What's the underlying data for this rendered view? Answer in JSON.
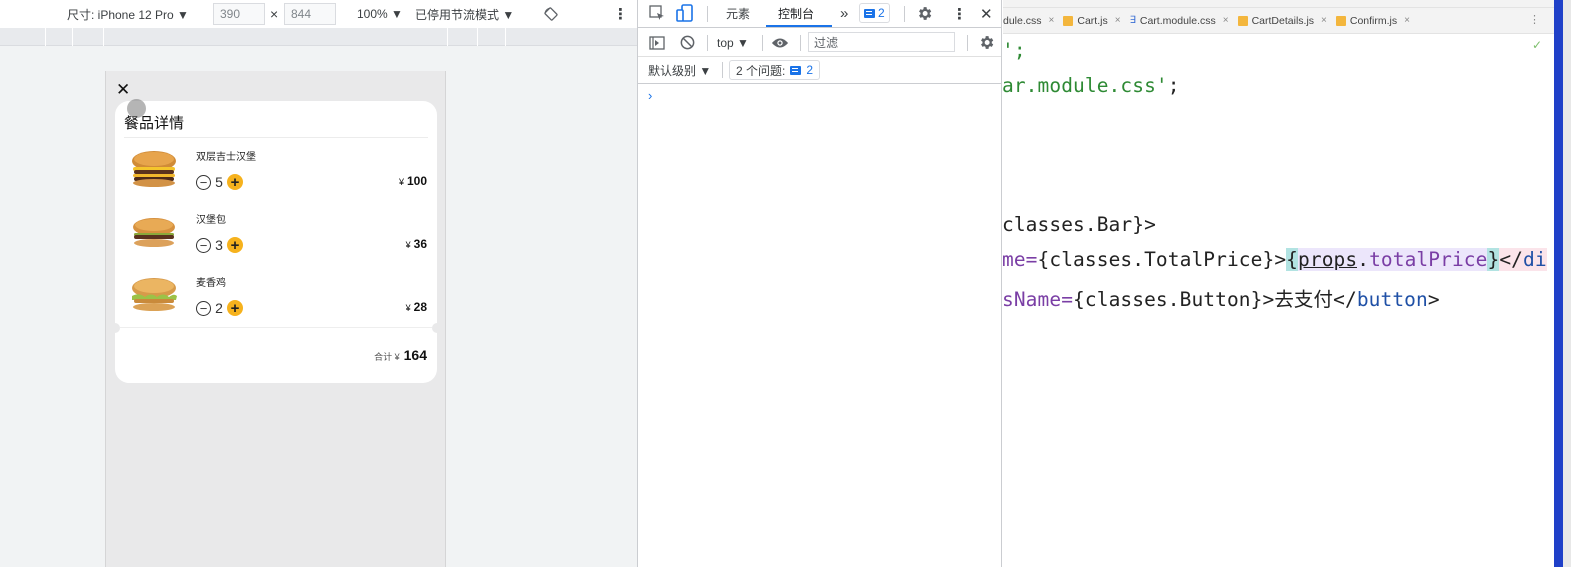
{
  "device_toolbar": {
    "size_label": "尺寸: iPhone 12 Pro ▼",
    "width": "390",
    "times": "×",
    "height": "844",
    "zoom": "100% ▼",
    "throttle": "已停用节流模式 ▼",
    "menu_dots": "⋮"
  },
  "cart": {
    "close": "✕",
    "title": "餐品详情",
    "items": [
      {
        "name": "双层吉士汉堡",
        "qty": "5",
        "currency": "¥",
        "price": "100"
      },
      {
        "name": "汉堡包",
        "qty": "3",
        "currency": "¥",
        "price": "36"
      },
      {
        "name": "麦香鸡",
        "qty": "2",
        "currency": "¥",
        "price": "28"
      }
    ],
    "minus": "−",
    "plus": "+",
    "total_label": "合计 ¥",
    "total_value": "164"
  },
  "devtools": {
    "tabs": {
      "elements": "元素",
      "console": "控制台",
      "more": "»"
    },
    "issues_badge_count": "2",
    "close": "✕",
    "context": "top ▼",
    "filter_placeholder": "过滤",
    "level": "默认级别 ▼",
    "issues_label": "2 个问题:",
    "issues_count": "2",
    "prompt": "›",
    "menu_dots": "⋮"
  },
  "editor": {
    "tabs": [
      {
        "name": "dule.css",
        "type": "css-partial"
      },
      {
        "name": "Cart.js",
        "type": "js"
      },
      {
        "name": "Cart.module.css",
        "type": "css"
      },
      {
        "name": "CartDetails.js",
        "type": "js"
      },
      {
        "name": "Confirm.js",
        "type": "js"
      }
    ],
    "tab_close": "×",
    "more": "⋮",
    "check": "✓",
    "code": {
      "l1": "';",
      "l2_str": "ar.module.css'",
      "l2_end": ";",
      "l3": "classes.Bar}>",
      "l4_attr": "me=",
      "l4_a": "{classes.TotalPrice}>",
      "l4_b1": "{",
      "l4_props": "props",
      "l4_dot": ".",
      "l4_total": "totalPrice",
      "l4_b2": "}",
      "l4_lt": "</",
      "l4_tag": "di",
      "l5_attr": "sName=",
      "l5_a": "{classes.Button}>去支付</",
      "l5_tag": "button",
      "l5_end": ">"
    }
  },
  "colors": {
    "accent_blue": "#1a73e8",
    "plus_yellow": "#f6b21d",
    "code_string": "#2e8a34",
    "code_attr": "#7a3ea5",
    "code_tag": "#1f50a6"
  }
}
